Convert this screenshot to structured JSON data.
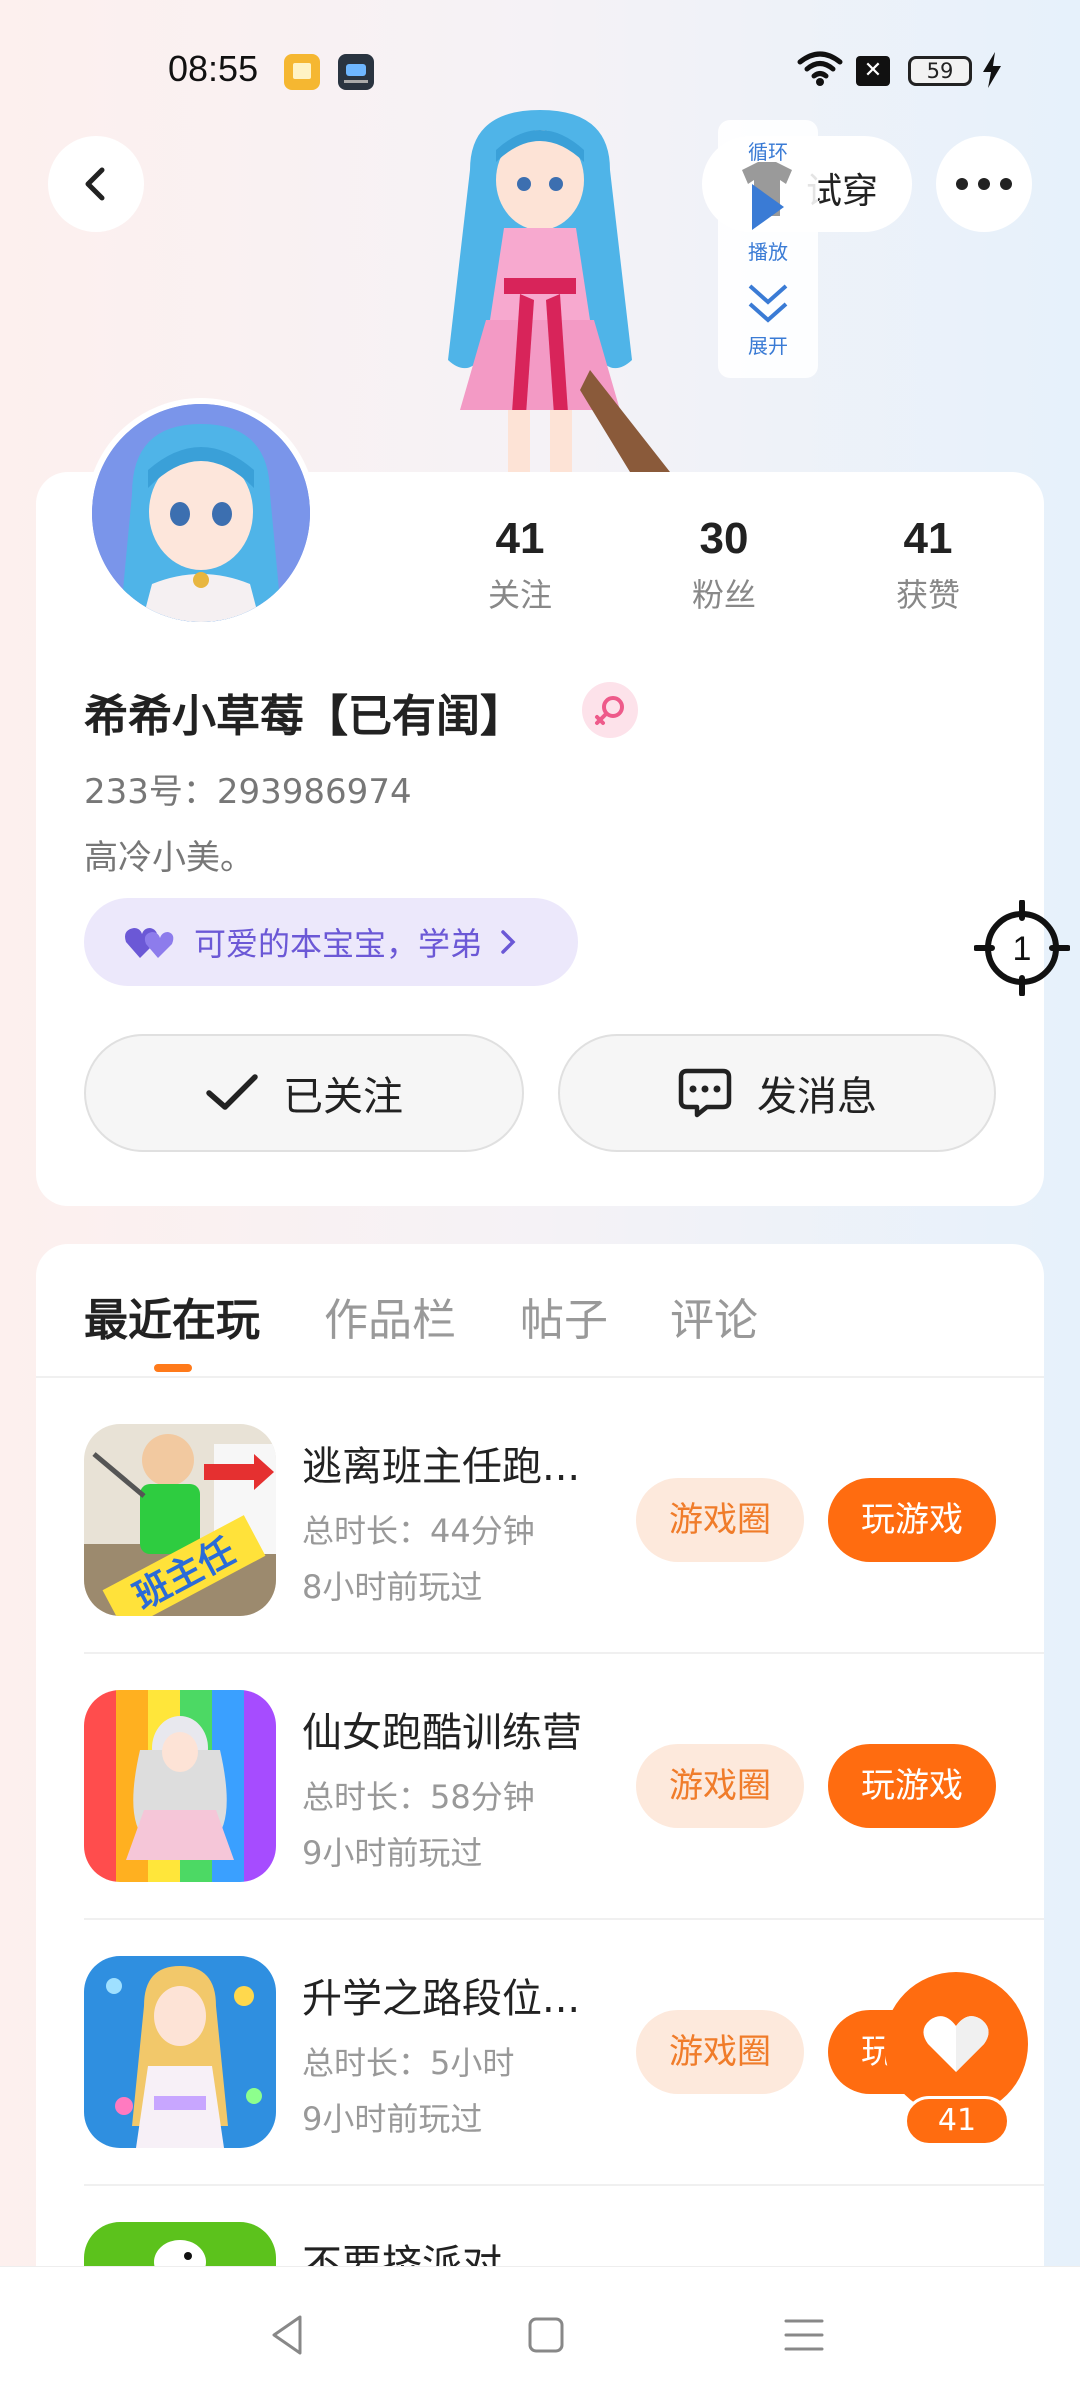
{
  "status_bar": {
    "time": "08:55",
    "battery": "59",
    "icons": [
      "reader-app-icon",
      "game-app-icon",
      "wifi-icon",
      "close-box-icon",
      "battery-icon",
      "charging-icon"
    ]
  },
  "header": {
    "try_on_label": "试穿",
    "player": {
      "loop_label": "循环",
      "play_label": "播放",
      "expand_label": "展开"
    }
  },
  "profile": {
    "stats": [
      {
        "value": "41",
        "label": "关注"
      },
      {
        "value": "30",
        "label": "粉丝"
      },
      {
        "value": "41",
        "label": "获赞"
      }
    ],
    "username": "希希小草莓【已有闺】",
    "uid": "233号：293986974",
    "bio": "高冷小美。",
    "relation_tag": "可爱的本宝宝，学弟",
    "follow_label": "已关注",
    "message_label": "发消息"
  },
  "tabs": [
    {
      "label": "最近在玩",
      "active": true
    },
    {
      "label": "作品栏",
      "active": false
    },
    {
      "label": "帖子",
      "active": false
    },
    {
      "label": "评论",
      "active": false
    }
  ],
  "games": [
    {
      "title": "逃离班主任跑...",
      "duration": "总时长：44分钟",
      "last_played": "8小时前玩过",
      "circle_label": "游戏圈",
      "play_label": "玩游戏"
    },
    {
      "title": "仙女跑酷训练营",
      "duration": "总时长：58分钟",
      "last_played": "9小时前玩过",
      "circle_label": "游戏圈",
      "play_label": "玩游戏"
    },
    {
      "title": "升学之路段位...",
      "duration": "总时长：5小时",
      "last_played": "9小时前玩过",
      "circle_label": "游戏圈",
      "play_label": "玩游戏"
    },
    {
      "title": "不要挤派对",
      "duration": "",
      "last_played": "",
      "circle_label": "",
      "play_label": ""
    }
  ],
  "thumb_text": {
    "game1_badge": "班主任"
  },
  "floating": {
    "like_count": "41",
    "target_number": "1"
  },
  "colors": {
    "accent_orange": "#ff6c10",
    "pill_orange_bg": "#fde9dc",
    "relation_purple": "#6b58d6",
    "player_blue": "#3a7bd5"
  }
}
